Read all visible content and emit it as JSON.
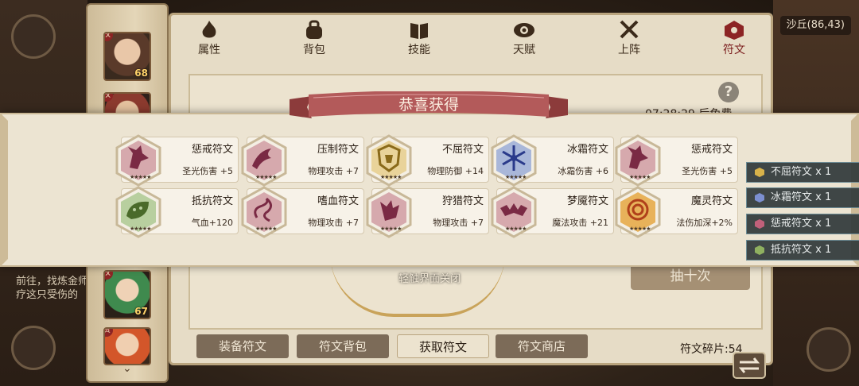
{
  "world": {
    "coords": "沙丘(86,43)",
    "quest_text": "前往，找炼金师疗这只受伤的"
  },
  "characters": [
    {
      "level": "68",
      "badge": "权",
      "portrait": "heroine-dark-hair"
    },
    {
      "level": "",
      "badge": "权",
      "portrait": "hero-red"
    },
    {
      "level": "67",
      "badge": "权",
      "portrait": "girl-green-hair"
    },
    {
      "level": "",
      "badge": "赏",
      "portrait": "hero-orange-hair"
    }
  ],
  "tabs": [
    {
      "label": "属性",
      "icon": "flame-icon"
    },
    {
      "label": "背包",
      "icon": "bag-icon"
    },
    {
      "label": "技能",
      "icon": "book-icon"
    },
    {
      "label": "天赋",
      "icon": "eye-icon"
    },
    {
      "label": "上阵",
      "icon": "crossed-swords-icon"
    },
    {
      "label": "符文",
      "icon": "rune-icon",
      "active": true
    }
  ],
  "panel": {
    "timer_text": "07:28:29 后免费",
    "draw_ten_label": "抽十次",
    "fragments_text": "符文碎片:54"
  },
  "bottom_buttons": [
    "装备符文",
    "符文背包",
    "获取符文",
    "符文商店"
  ],
  "active_bottom_index": 2,
  "modal": {
    "title": "恭喜获得",
    "close_hint": "轻触界面关闭",
    "runes": [
      {
        "name": "惩戒符文",
        "stat": "圣光伤害    +5",
        "color": "#d6a9ad",
        "glyph": "wolf"
      },
      {
        "name": "压制符文",
        "stat": "物理攻击    +7",
        "color": "#d6a9ad",
        "glyph": "dragon"
      },
      {
        "name": "不屈符文",
        "stat": "物理防御 +14",
        "color": "#e9d39a",
        "glyph": "helm"
      },
      {
        "name": "冰霜符文",
        "stat": "冰霜伤害    +6",
        "color": "#a9b7d9",
        "glyph": "snow"
      },
      {
        "name": "惩戒符文",
        "stat": "圣光伤害    +5",
        "color": "#d6a9ad",
        "glyph": "wolf"
      },
      {
        "name": "抵抗符文",
        "stat": "气血+120",
        "color": "#b8cf9f",
        "glyph": "leaf"
      },
      {
        "name": "嗜血符文",
        "stat": "物理攻击    +7",
        "color": "#d6a9ad",
        "glyph": "serpent"
      },
      {
        "name": "狩猎符文",
        "stat": "物理攻击    +7",
        "color": "#d6a9ad",
        "glyph": "fox"
      },
      {
        "name": "梦魇符文",
        "stat": "魔法攻击 +21",
        "color": "#d6a9ad",
        "glyph": "bat"
      },
      {
        "name": "魔灵符文",
        "stat": "法伤加深+2%",
        "color": "#e8b25a",
        "glyph": "swirl"
      }
    ],
    "stars": "★★★★★"
  },
  "summary": [
    {
      "label": "不屈符文  x 1",
      "color": "#d8b24a"
    },
    {
      "label": "冰霜符文  x 1",
      "color": "#7c8fd0"
    },
    {
      "label": "惩戒符文  x 1",
      "color": "#c0607a"
    },
    {
      "label": "抵抗符文  x 1",
      "color": "#8fb060"
    }
  ]
}
